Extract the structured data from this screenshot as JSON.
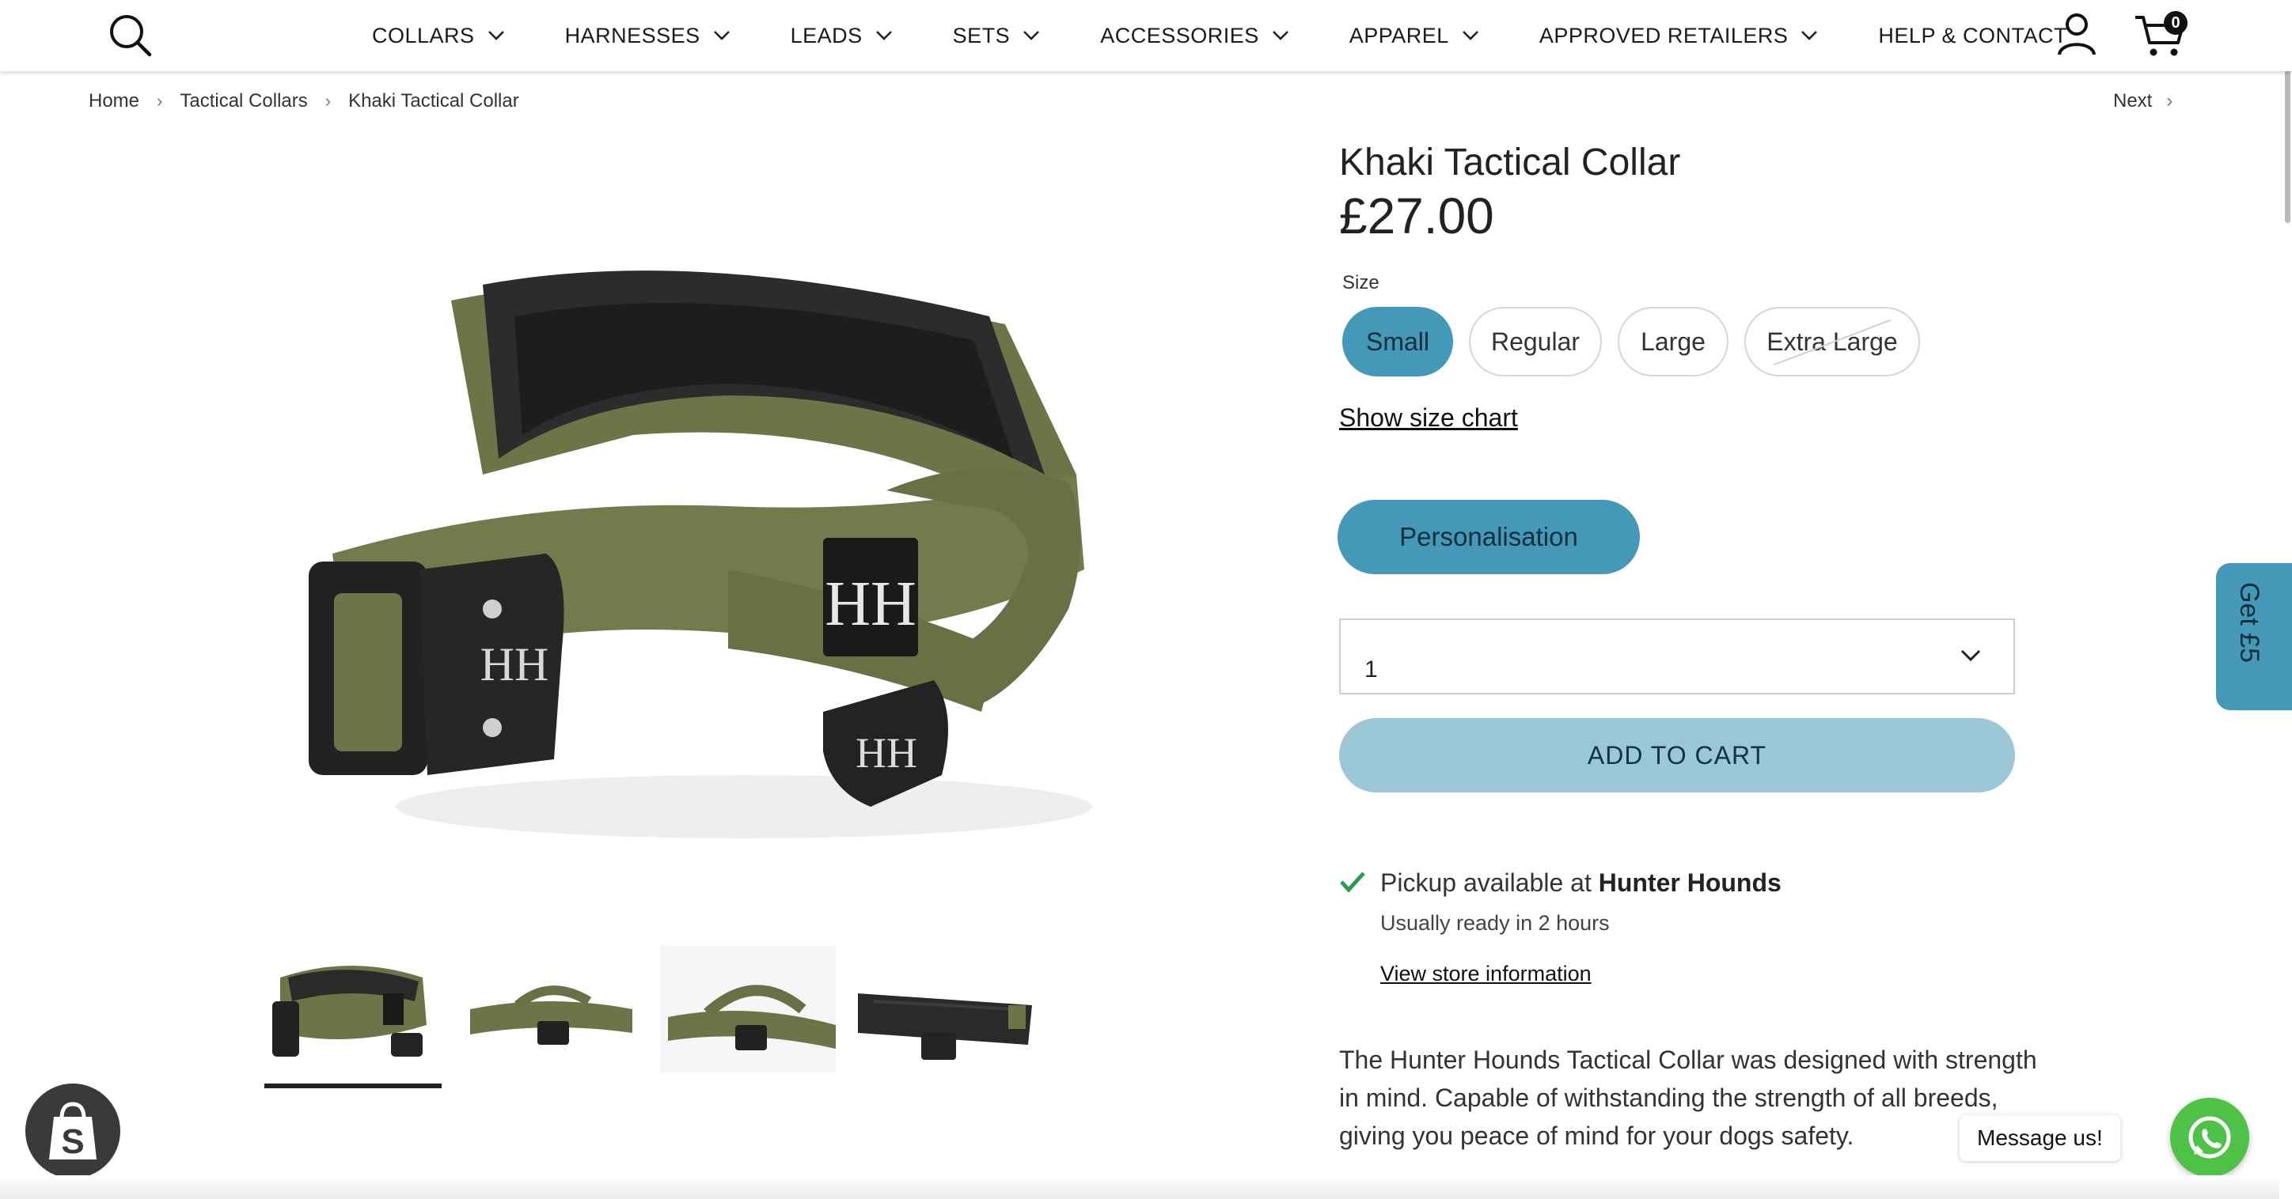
{
  "header": {
    "nav": [
      "COLLARS",
      "HARNESSES",
      "LEADS",
      "SETS",
      "ACCESSORIES",
      "APPAREL",
      "APPROVED RETAILERS",
      "HELP & CONTACT"
    ],
    "cart_count": "0"
  },
  "breadcrumb": {
    "items": [
      "Home",
      "Tactical Collars",
      "Khaki Tactical Collar"
    ],
    "next_label": "Next"
  },
  "product": {
    "title": "Khaki Tactical Collar",
    "price": "£27.00",
    "size_label": "Size",
    "sizes": [
      "Small",
      "Regular",
      "Large",
      "Extra Large"
    ],
    "selected_size": "Small",
    "size_chart_link": "Show size chart",
    "personalisation_label": "Personalisation",
    "quantity": "1",
    "add_to_cart_label": "ADD TO CART",
    "image_brand_mark": "HH"
  },
  "pickup": {
    "prefix": "Pickup available at ",
    "location": "Hunter Hounds",
    "ready_text": "Usually ready in 2 hours",
    "store_info_link": "View store information"
  },
  "description": "The Hunter Hounds Tactical Collar was designed with strength in mind. Capable of withstanding the strength of all breeds, giving you peace of mind for your dogs safety.",
  "widgets": {
    "side_tab_label": "Get £5",
    "message_label": "Message us!"
  },
  "colors": {
    "accent": "#4598b8",
    "accent_light": "#9cc7d6",
    "check_green": "#2e9a56",
    "whatsapp_green": "#4dc247",
    "collar_khaki": "#6f7448"
  }
}
